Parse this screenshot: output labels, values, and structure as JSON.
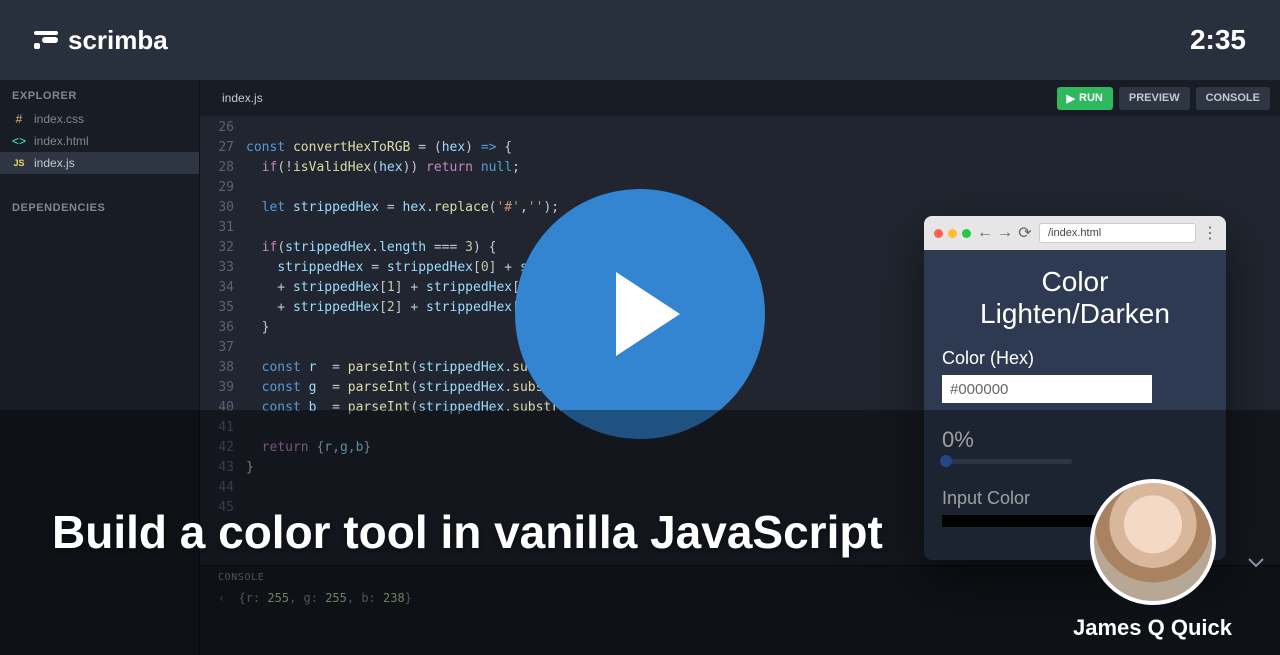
{
  "header": {
    "brand": "scrimba",
    "timer": "2:35"
  },
  "sidebar": {
    "explorer_label": "EXPLORER",
    "dependencies_label": "DEPENDENCIES",
    "files": [
      {
        "name": "index.css"
      },
      {
        "name": "index.html"
      },
      {
        "name": "index.js"
      }
    ]
  },
  "editor": {
    "active_tab": "index.js",
    "run_label": "RUN",
    "preview_label": "PREVIEW",
    "console_label": "CONSOLE",
    "lines": [
      {
        "n": 26,
        "html": ""
      },
      {
        "n": 27,
        "html": "<span class='const'>const</span> <span class='fn'>convertHexToRGB</span> = (<span class='param'>hex</span>) <span class='const'>=&gt;</span> {"
      },
      {
        "n": 28,
        "html": "  <span class='kw'>if</span>(!<span class='fn'>isValidHex</span>(<span class='param'>hex</span>)) <span class='kw'>return</span> <span class='const'>null</span>;"
      },
      {
        "n": 29,
        "html": ""
      },
      {
        "n": 30,
        "html": "  <span class='const'>let</span> <span class='param'>strippedHex</span> = <span class='param'>hex</span>.<span class='fn'>replace</span>(<span class='str'>'#'</span>,<span class='str'>''</span>);"
      },
      {
        "n": 31,
        "html": ""
      },
      {
        "n": 32,
        "html": "  <span class='kw'>if</span>(<span class='param'>strippedHex</span>.<span class='param'>length</span> === <span class='num'>3</span>) {"
      },
      {
        "n": 33,
        "html": "    <span class='param'>strippedHex</span> = <span class='param'>strippedHex</span>[<span class='num'>0</span>] + <span class='param'>strippedHex</span>[<span class='num'>0</span>]"
      },
      {
        "n": 34,
        "html": "    + <span class='param'>strippedHex</span>[<span class='num'>1</span>] + <span class='param'>strippedHex</span>[<span class='num'>1</span>]"
      },
      {
        "n": 35,
        "html": "    + <span class='param'>strippedHex</span>[<span class='num'>2</span>] + <span class='param'>strippedHex</span>[<span class='num'>2</span>]"
      },
      {
        "n": 36,
        "html": "  }"
      },
      {
        "n": 37,
        "html": ""
      },
      {
        "n": 38,
        "html": "  <span class='const'>const</span> <span class='param'>r</span>  = <span class='fn'>parseInt</span>(<span class='param'>strippedHex</span>.<span class='fn'>substring</span>(<span class='num'>0</span>,<span class='num'>2</span>), <span class='num'>16</span>);"
      },
      {
        "n": 39,
        "html": "  <span class='const'>const</span> <span class='param'>g</span>  = <span class='fn'>parseInt</span>(<span class='param'>strippedHex</span>.<span class='fn'>substring</span>(<span class='num'>2</span>,<span class='num'>4</span>), <span class='num'>16</span>);"
      },
      {
        "n": 40,
        "html": "  <span class='const'>const</span> <span class='param'>b</span>  = <span class='fn'>parseInt</span>(<span class='param'>strippedHex</span>.<span class='fn'>substring</span>(<span class='num'>4</span>,<span class='num'>6</span>), <span class='num'>16</span>);"
      },
      {
        "n": 41,
        "html": ""
      },
      {
        "n": 42,
        "html": "  <span class='kw'>return</span> {<span class='param'>r</span>,<span class='param'>g</span>,<span class='param'>b</span>}"
      },
      {
        "n": 43,
        "html": "}"
      },
      {
        "n": 44,
        "html": ""
      },
      {
        "n": 45,
        "html": ""
      }
    ]
  },
  "console": {
    "label": "CONSOLE",
    "output_html": "{r: <span class='num'>255</span>, g: <span class='num'>255</span>, b: <span class='num'>238</span>}"
  },
  "preview": {
    "url": "/index.html",
    "title_line1": "Color",
    "title_line2": "Lighten/Darken",
    "color_label": "Color (Hex)",
    "color_value": "#000000",
    "percent": "0%",
    "input_color_label": "Input Color"
  },
  "overlay": {
    "lesson_title": "Build a color tool in vanilla JavaScript",
    "author": "James Q Quick"
  }
}
